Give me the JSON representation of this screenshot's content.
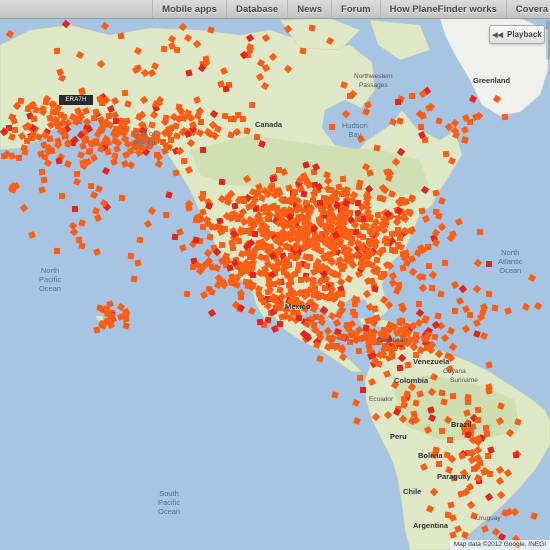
{
  "nav": {
    "items": [
      "Mobile apps",
      "Database",
      "News",
      "Forum",
      "How PlaneFinder works",
      "Covera"
    ]
  },
  "controls": {
    "playback_label": "Playback",
    "playback_icon": "rewind-icon"
  },
  "flight_tag": "ERA7H",
  "map": {
    "labels": {
      "greenland": "Greenland",
      "canada": "Canada",
      "hudson_bay": "Hudson\nBay",
      "northwestern_passages": "Northwestern\nPassages",
      "gulf_of_alaska": "Gulf of\nAlaska",
      "north_pacific": "North\nPacific\nOcean",
      "north_atlantic": "North\nAtlantic\nOcean",
      "mexico": "Mexico",
      "venezuela": "Venezuela",
      "colombia": "Colombia",
      "guyana": "Guyana",
      "suriname": "Suriname",
      "ecuador": "Ecuador",
      "peru": "Peru",
      "brazil": "Brazil",
      "bolivia": "Bolivia",
      "paraguay": "Paraguay",
      "chile": "Chile",
      "argentina": "Argentina",
      "uruguay": "Uruguay",
      "south_pacific": "South\nPacific\nOcean",
      "caribbean": "Caribbean"
    },
    "colors": {
      "water": "#a7c5e3",
      "land": "#dfe8c6",
      "forest": "#c7dba8",
      "ice": "#f2f2f0",
      "plane": "#ff5e16",
      "plane_highlight": "#e1261c"
    }
  },
  "attribution": "Map data ©2012 Google, INEGI"
}
